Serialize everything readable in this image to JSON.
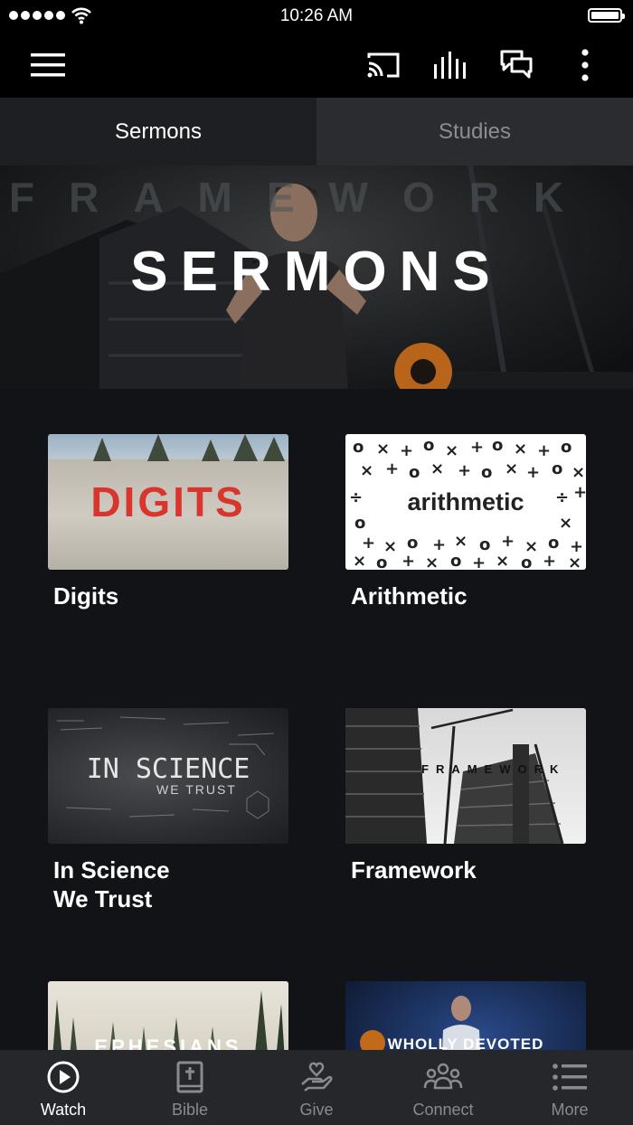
{
  "status_bar": {
    "time": "10:26 AM"
  },
  "toolbar": {
    "icons": [
      "menu-icon",
      "cast-icon",
      "audio-bars-icon",
      "chat-icon",
      "more-vertical-icon"
    ]
  },
  "tabs": [
    {
      "label": "Sermons",
      "active": true
    },
    {
      "label": "Studies",
      "active": false
    }
  ],
  "hero": {
    "title": "SERMONS",
    "backdrop_text": "FRAMEWORK"
  },
  "series": [
    {
      "title": "Digits",
      "thumb_text": "DIGITS"
    },
    {
      "title": "Arithmetic",
      "thumb_text": "arithmetic"
    },
    {
      "title_line1": "In Science",
      "title_line2": "We Trust",
      "thumb_text": "IN SCIENCE",
      "thumb_sub": "WE TRUST"
    },
    {
      "title": "Framework",
      "thumb_text": "FRAMEWORK"
    },
    {
      "thumb_text": "EPHESIANS"
    },
    {
      "thumb_text": "WHOLLY DEVOTED"
    }
  ],
  "bottom_nav": [
    {
      "label": "Watch",
      "icon": "play-circle-icon",
      "active": true
    },
    {
      "label": "Bible",
      "icon": "bible-icon",
      "active": false
    },
    {
      "label": "Give",
      "icon": "give-hand-heart-icon",
      "active": false
    },
    {
      "label": "Connect",
      "icon": "people-icon",
      "active": false
    },
    {
      "label": "More",
      "icon": "list-icon",
      "active": false
    }
  ],
  "colors": {
    "background": "#121316",
    "bar": "#000000",
    "accent_red": "#d8362c"
  }
}
